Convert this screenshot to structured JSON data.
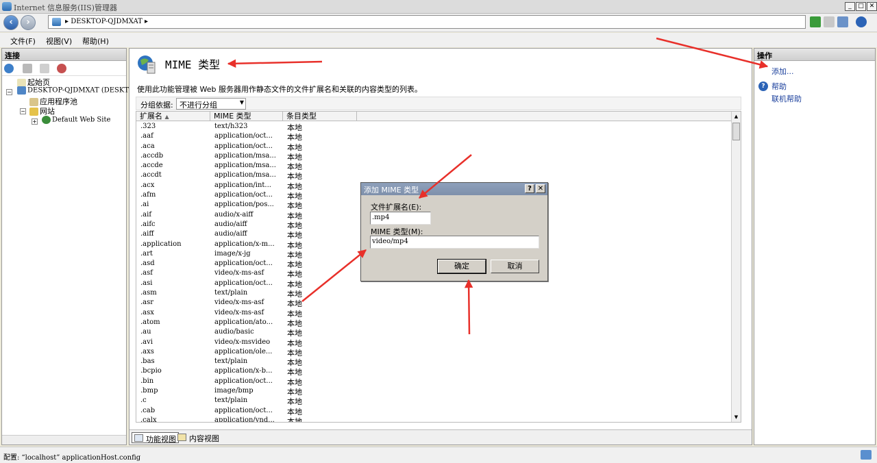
{
  "window": {
    "title": "Internet 信息服务(IIS)管理器"
  },
  "address": {
    "crumb": "DESKTOP-QJDMXAT"
  },
  "menu": {
    "file": "文件(F)",
    "view": "视图(V)",
    "help": "帮助(H)"
  },
  "connections": {
    "header": "连接",
    "tree": {
      "start": "起始页",
      "server": "DESKTOP-QJDMXAT (DESKTOP-Q",
      "apppools": "应用程序池",
      "sites": "网站",
      "default_site": "Default Web Site"
    }
  },
  "feature": {
    "title": "MIME 类型",
    "description": "使用此功能管理被 Web 服务器用作静态文件的文件扩展名和关联的内容类型的列表。",
    "group_label": "分组依据:",
    "group_value": "不进行分组",
    "columns": [
      "扩展名",
      "MIME 类型",
      "条目类型"
    ],
    "rows": [
      [
        ".323",
        "text/h323",
        "本地"
      ],
      [
        ".aaf",
        "application/oct...",
        "本地"
      ],
      [
        ".aca",
        "application/oct...",
        "本地"
      ],
      [
        ".accdb",
        "application/msa...",
        "本地"
      ],
      [
        ".accde",
        "application/msa...",
        "本地"
      ],
      [
        ".accdt",
        "application/msa...",
        "本地"
      ],
      [
        ".acx",
        "application/int...",
        "本地"
      ],
      [
        ".afm",
        "application/oct...",
        "本地"
      ],
      [
        ".ai",
        "application/pos...",
        "本地"
      ],
      [
        ".aif",
        "audio/x-aiff",
        "本地"
      ],
      [
        ".aifc",
        "audio/aiff",
        "本地"
      ],
      [
        ".aiff",
        "audio/aiff",
        "本地"
      ],
      [
        ".application",
        "application/x-m...",
        "本地"
      ],
      [
        ".art",
        "image/x-jg",
        "本地"
      ],
      [
        ".asd",
        "application/oct...",
        "本地"
      ],
      [
        ".asf",
        "video/x-ms-asf",
        "本地"
      ],
      [
        ".asi",
        "application/oct...",
        "本地"
      ],
      [
        ".asm",
        "text/plain",
        "本地"
      ],
      [
        ".asr",
        "video/x-ms-asf",
        "本地"
      ],
      [
        ".asx",
        "video/x-ms-asf",
        "本地"
      ],
      [
        ".atom",
        "application/ato...",
        "本地"
      ],
      [
        ".au",
        "audio/basic",
        "本地"
      ],
      [
        ".avi",
        "video/x-msvideo",
        "本地"
      ],
      [
        ".axs",
        "application/ole...",
        "本地"
      ],
      [
        ".bas",
        "text/plain",
        "本地"
      ],
      [
        ".bcpio",
        "application/x-b...",
        "本地"
      ],
      [
        ".bin",
        "application/oct...",
        "本地"
      ],
      [
        ".bmp",
        "image/bmp",
        "本地"
      ],
      [
        ".c",
        "text/plain",
        "本地"
      ],
      [
        ".cab",
        "application/oct...",
        "本地"
      ],
      [
        ".calx",
        "application/vnd...",
        "本地"
      ]
    ],
    "views": {
      "features": "功能视图",
      "content": "内容视图"
    }
  },
  "actions": {
    "header": "操作",
    "add": "添加...",
    "help": "帮助",
    "online_help": "联机帮助"
  },
  "status": {
    "text": "配置: “localhost” applicationHost.config"
  },
  "dialog": {
    "title": "添加 MIME 类型",
    "help_btn": "?",
    "close_btn": "✕",
    "ext_label": "文件扩展名(E):",
    "ext_value": ".mp4",
    "mime_label": "MIME 类型(M):",
    "mime_value": "video/mp4",
    "ok": "确定",
    "cancel": "取消"
  },
  "colors": {
    "arrow": "#e8302a",
    "link": "#1a3f9c",
    "dialog_title": "#8496b2"
  }
}
